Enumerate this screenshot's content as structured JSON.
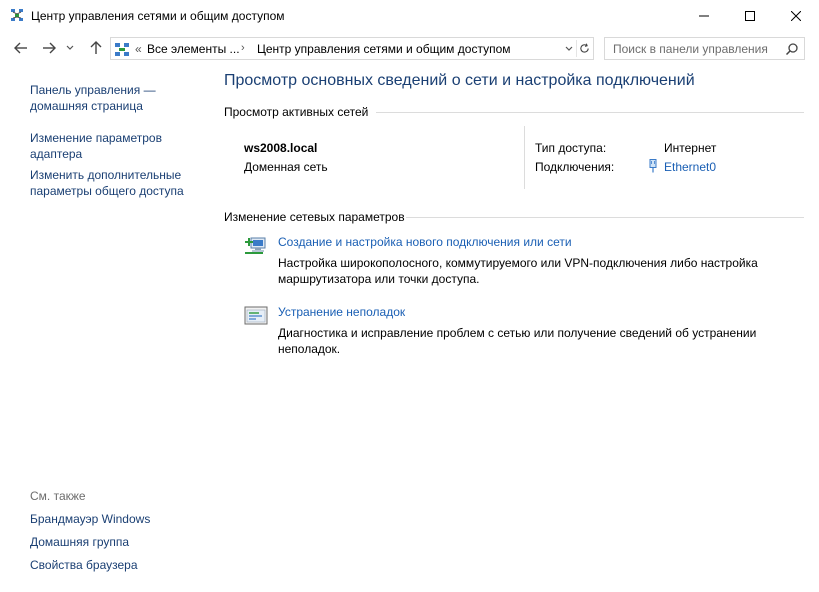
{
  "window": {
    "title": "Центр управления сетями и общим доступом"
  },
  "address": {
    "overflow": "«",
    "crumb1": "Все элементы ...",
    "separator": "›",
    "crumb2": "Центр управления сетями и общим доступом"
  },
  "search": {
    "placeholder": "Поиск в панели управления"
  },
  "sidebar": {
    "items": [
      {
        "label": "Панель управления — домашняя страница"
      },
      {
        "label": "Изменение параметров адаптера"
      },
      {
        "label": "Изменить дополнительные параметры общего доступа"
      }
    ],
    "see_also_title": "См. также",
    "see_also": [
      {
        "label": "Брандмауэр Windows"
      },
      {
        "label": "Домашняя группа"
      },
      {
        "label": "Свойства браузера"
      }
    ]
  },
  "main": {
    "title": "Просмотр основных сведений о сети и настройка подключений",
    "active_networks_header": "Просмотр активных сетей",
    "network": {
      "name": "ws2008.local",
      "type": "Доменная сеть",
      "access_label": "Тип доступа:",
      "access_value": "Интернет",
      "connections_label": "Подключения:",
      "connections_value": "Ethernet0"
    },
    "change_settings_header": "Изменение сетевых параметров",
    "tasks": [
      {
        "icon": "new-connection-icon",
        "link": "Создание и настройка нового подключения или сети",
        "description": "Настройка широкополосного, коммутируемого или VPN-подключения либо настройка маршрутизатора или точки доступа."
      },
      {
        "icon": "troubleshoot-icon",
        "link": "Устранение неполадок",
        "description": "Диагностика и исправление проблем с сетью или получение сведений об устранении неполадок."
      }
    ]
  },
  "colors": {
    "link": "#1a5fb4",
    "heading": "#1a3f73"
  }
}
